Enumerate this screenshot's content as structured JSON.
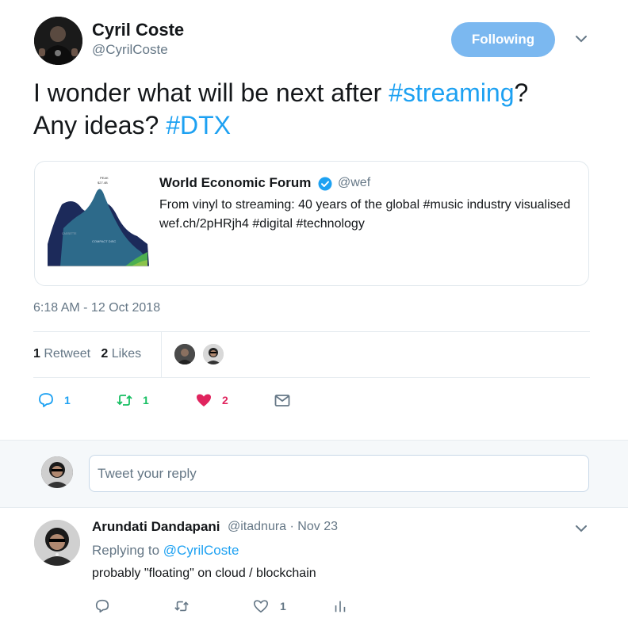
{
  "author": {
    "name": "Cyril Coste",
    "handle": "@CyrilCoste",
    "follow_label": "Following"
  },
  "tweet": {
    "text_part1": "I wonder what will be next after ",
    "hashtag1": "#streaming",
    "text_part2": "?",
    "text_part3": "Any ideas? ",
    "hashtag2": "#DTX"
  },
  "quote": {
    "author": "World Economic Forum",
    "handle": "@wef",
    "text": "From vinyl to streaming: 40 years of the global #music industry visualised wef.ch/2pHRjh4 #digital #technology",
    "thumb_labels": {
      "peak": "PEAK",
      "peak_value": "$27.4B",
      "cassette": "CASSETTE",
      "cd": "COMPACT DISC"
    }
  },
  "timestamp": "6:18 AM - 12 Oct 2018",
  "stats": {
    "retweets_count": "1",
    "retweets_label": "Retweet",
    "likes_count": "2",
    "likes_label": "Likes"
  },
  "actions": {
    "reply_count": "1",
    "retweet_count": "1",
    "like_count": "2"
  },
  "composer": {
    "placeholder": "Tweet your reply"
  },
  "reply": {
    "name": "Arundati Dandapani",
    "handle": "@itadnura",
    "separator": "·",
    "date": "Nov 23",
    "replying_prefix": "Replying to ",
    "replying_handle": "@CyrilCoste",
    "text": "probably \"floating\" on cloud / blockchain",
    "like_count": "1"
  },
  "colors": {
    "accent": "#1da1f2",
    "follow_button": "#7bb8f0",
    "retweet_green": "#17bf63",
    "like_red": "#e0245e",
    "muted": "#657786"
  },
  "icons": [
    "chevron-down-icon",
    "verified-badge-icon",
    "reply-icon",
    "retweet-icon",
    "heart-icon",
    "mail-icon",
    "analytics-icon"
  ]
}
